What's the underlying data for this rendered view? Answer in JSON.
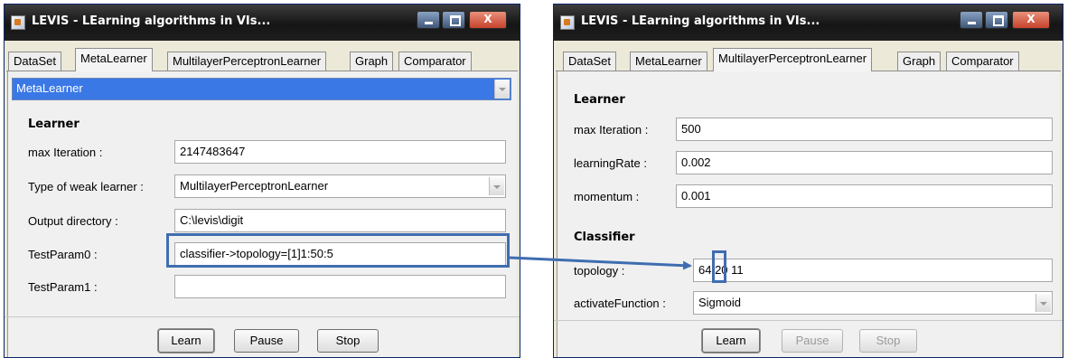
{
  "left_window": {
    "title": "LEVIS - LEarning algorithms in VIs...",
    "tabs": [
      "DataSet",
      "MetaLearner",
      "MultilayerPerceptronLearner",
      "Graph",
      "Comparator"
    ],
    "active_tab": "MetaLearner",
    "learner_select": "MetaLearner",
    "section_learner": "Learner",
    "fields": {
      "max_iteration": {
        "label": "max Iteration :",
        "value": "2147483647"
      },
      "weak_learner": {
        "label": "Type of weak learner :",
        "value": "MultilayerPerceptronLearner"
      },
      "output_dir": {
        "label": "Output directory :",
        "value": "C:\\levis\\digit"
      },
      "test_param0": {
        "label": "TestParam0 :",
        "value": "classifier->topology=[1]1:50:5"
      },
      "test_param1": {
        "label": "TestParam1 :",
        "value": ""
      }
    },
    "buttons": {
      "learn": "Learn",
      "pause": "Pause",
      "stop": "Stop"
    }
  },
  "right_window": {
    "title": "LEVIS - LEarning algorithms in VIs...",
    "tabs": [
      "DataSet",
      "MetaLearner",
      "MultilayerPerceptronLearner",
      "Graph",
      "Comparator"
    ],
    "active_tab": "MultilayerPerceptronLearner",
    "section_learner": "Learner",
    "section_classifier": "Classifier",
    "fields": {
      "max_iteration": {
        "label": "max Iteration :",
        "value": "500"
      },
      "learning_rate": {
        "label": "learningRate :",
        "value": "0.002"
      },
      "momentum": {
        "label": "momentum :",
        "value": "0.001"
      },
      "topology": {
        "label": "topology :",
        "value": "64 20 11"
      },
      "activate_function": {
        "label": "activateFunction :",
        "value": "Sigmoid"
      }
    },
    "buttons": {
      "learn": "Learn",
      "pause": "Pause",
      "stop": "Stop"
    }
  },
  "colors": {
    "title_bar": "#1e1e1e",
    "selected_combo": "#3a78e6",
    "annotation": "#3f6db0",
    "panel": "#f0f0f0"
  },
  "icons": [
    "app-icon",
    "minimize-icon",
    "maximize-icon",
    "close-icon",
    "chevron-down-icon",
    "arrow-icon"
  ]
}
